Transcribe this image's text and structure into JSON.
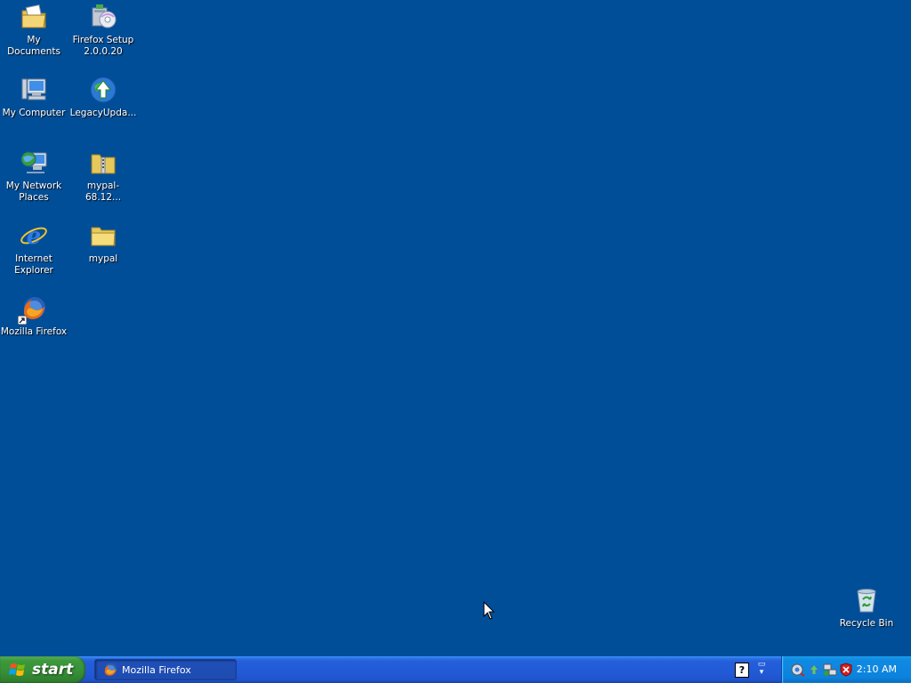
{
  "desktop": {
    "background_color": "#004e98",
    "icons": [
      {
        "label": "My Documents",
        "icon": "my-documents-icon"
      },
      {
        "label": "Firefox Setup\n2.0.0.20",
        "icon": "installer-icon"
      },
      {
        "label": "My Computer",
        "icon": "my-computer-icon"
      },
      {
        "label": "LegacyUpda...",
        "icon": "legacy-update-icon"
      },
      {
        "label": "My Network\nPlaces",
        "icon": "network-places-icon"
      },
      {
        "label": "mypal-68.12...",
        "icon": "zip-folder-icon"
      },
      {
        "label": "Internet\nExplorer",
        "icon": "internet-explorer-icon"
      },
      {
        "label": "mypal",
        "icon": "folder-icon"
      },
      {
        "label": "Mozilla Firefox",
        "icon": "firefox-icon"
      },
      {
        "label": "Recycle Bin",
        "icon": "recycle-bin-icon"
      }
    ]
  },
  "taskbar": {
    "start_label": "start",
    "tasks": [
      {
        "label": "Mozilla Firefox",
        "icon": "firefox-icon",
        "active": false
      }
    ],
    "help_glyph": "?",
    "tray_icons": [
      "network-icon",
      "update-icon",
      "network-connection-icon",
      "security-alert-icon"
    ],
    "clock": "2:10 AM"
  },
  "colors": {
    "taskbar_blue": "#245edb",
    "start_green": "#3c9a3c",
    "tray_blue": "#0c82dc"
  }
}
